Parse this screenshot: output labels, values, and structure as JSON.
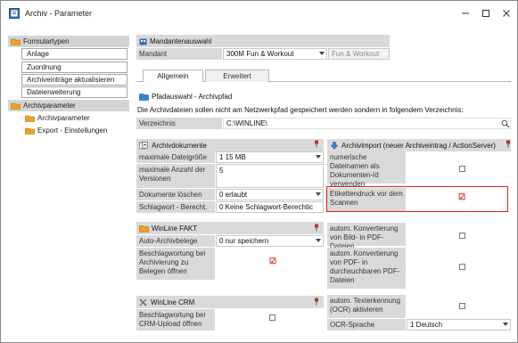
{
  "window": {
    "title": "Archiv - Parameter"
  },
  "nav": {
    "groups": [
      {
        "label": "Formulartypen",
        "children": [
          "Anlage",
          "Zuordnung",
          "Archiveinträge aktualisieren",
          "Dateierweiterung"
        ]
      },
      {
        "label": "Archivparameter",
        "children": [
          "Archivparameter",
          "Export - Einstellungen"
        ]
      }
    ]
  },
  "mandant": {
    "header": "Mandantenauswahl",
    "label": "Mandant",
    "value": "300M Fun & Workout",
    "display": "Fun & Workout"
  },
  "tabs": [
    "Allgemein",
    "Erweitert"
  ],
  "pfad": {
    "header": "Pfadauswahl - Archivpfad",
    "note": "Die Archivdateien sollen nicht am Netzwerkpfad gespeichert werden sondern in folgendem Verzeichnis:",
    "label": "Verzeichnis",
    "value": "C:\\WINLINE\\"
  },
  "archivdokumente": {
    "header": "Archivdokumente",
    "rows": [
      {
        "label": "maximale Dateigröße",
        "value": "1 15 MB"
      },
      {
        "label": "maximale Anzahl der Versionen",
        "value": "5"
      },
      {
        "label": "Dokumente löschen",
        "value": "0 erlaubt"
      },
      {
        "label": "Schlagwort - Berecht.",
        "value": "0 Keine Schlagwort-Berechtic"
      }
    ]
  },
  "fakt": {
    "header": "WinLine FAKT",
    "rows": [
      {
        "label": "Auto-Archivbelege",
        "value": "0 nur speichern"
      },
      {
        "label": "Beschlagwortung bei Archivierung zu Belegen öffnen",
        "checked": true
      }
    ]
  },
  "crm": {
    "header": "WinLine CRM",
    "rows": [
      {
        "label": "Beschlagwortung bei CRM-Upload öffnen",
        "checked": false
      }
    ]
  },
  "archivimport": {
    "header": "Archivimport (neuer Archiveintrag / ActionServer)",
    "rows": [
      {
        "label": "numerische Dateinamen als Dokumenten-Id verwenden",
        "checked": false
      },
      {
        "label": "Etikettendruck vor dem Scannen",
        "checked": true
      },
      {
        "label": "autom. Konvertierung von Bild- in PDF-Dateien",
        "checked": false
      },
      {
        "label": "autom. Konvertierung von PDF- in durchsuchbaren PDF-Dateien",
        "checked": false
      },
      {
        "label": "autom. Texterkennung (OCR) aktivieren",
        "checked": false
      },
      {
        "label": "OCR-Sprache",
        "value": "1 Deutsch"
      }
    ]
  },
  "colors": {
    "highlight": "#e02020",
    "check": "#d21e1e",
    "folder": "#f0a020",
    "header_bg": "#d9d9d9"
  }
}
